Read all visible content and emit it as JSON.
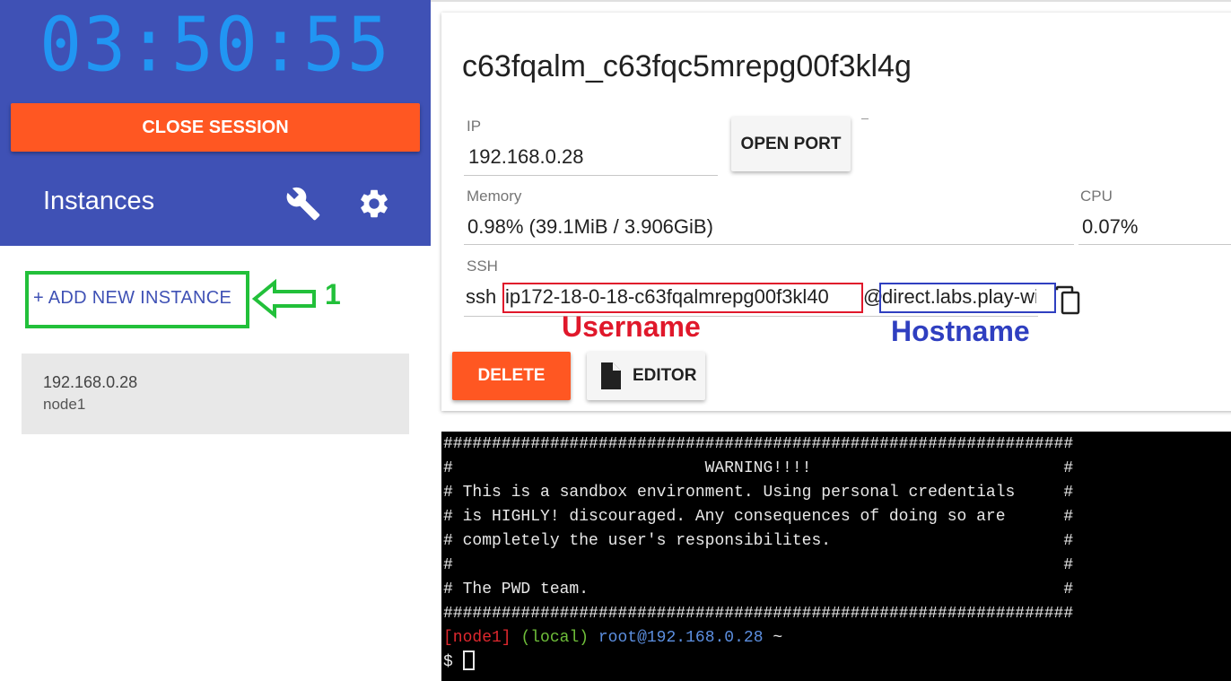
{
  "sidebar": {
    "timer": "03:50:55",
    "close_session_label": "CLOSE SESSION",
    "instances_title": "Instances",
    "add_instance_label": "+ ADD NEW INSTANCE",
    "instances": [
      {
        "ip": "192.168.0.28",
        "name": "node1"
      }
    ]
  },
  "annotations": {
    "step_number": "1",
    "username_label": "Username",
    "hostname_label": "Hostname",
    "colors": {
      "green": "#22c03a",
      "red": "#e0182b",
      "blue": "#2f3fc0"
    }
  },
  "instance": {
    "title": "c63fqalm_c63fqc5mrepg00f3kl4g",
    "ip_label": "IP",
    "ip_value": "192.168.0.28",
    "open_port_label": "OPEN PORT",
    "memory_label": "Memory",
    "memory_value": "0.98% (39.1MiB / 3.906GiB)",
    "cpu_label": "CPU",
    "cpu_value": "0.07%",
    "ssh_label": "SSH",
    "ssh_prefix": "ssh",
    "ssh_user": "ip172-18-0-18-c63fqalmrepg00f3kl40",
    "ssh_at": "@",
    "ssh_host": "direct.labs.play-with-docker.com",
    "delete_label": "DELETE",
    "editor_label": "EDITOR"
  },
  "terminal": {
    "lines": [
      "#################################################################",
      "#                          WARNING!!!!                          #",
      "# This is a sandbox environment. Using personal credentials     #",
      "# is HIGHLY! discouraged. Any consequences of doing so are      #",
      "# completely the user's responsibilites.                        #",
      "#                                                               #",
      "# The PWD team.                                                 #",
      "#################################################################"
    ],
    "prompt_node": "[node1]",
    "prompt_local": "(local)",
    "prompt_user": "root@192.168.0.28",
    "prompt_tilde": "~",
    "prompt_symbol": "$"
  },
  "icons": [
    "wrench-icon",
    "gear-icon",
    "copy-icon",
    "file-icon",
    "arrow-left-icon"
  ]
}
